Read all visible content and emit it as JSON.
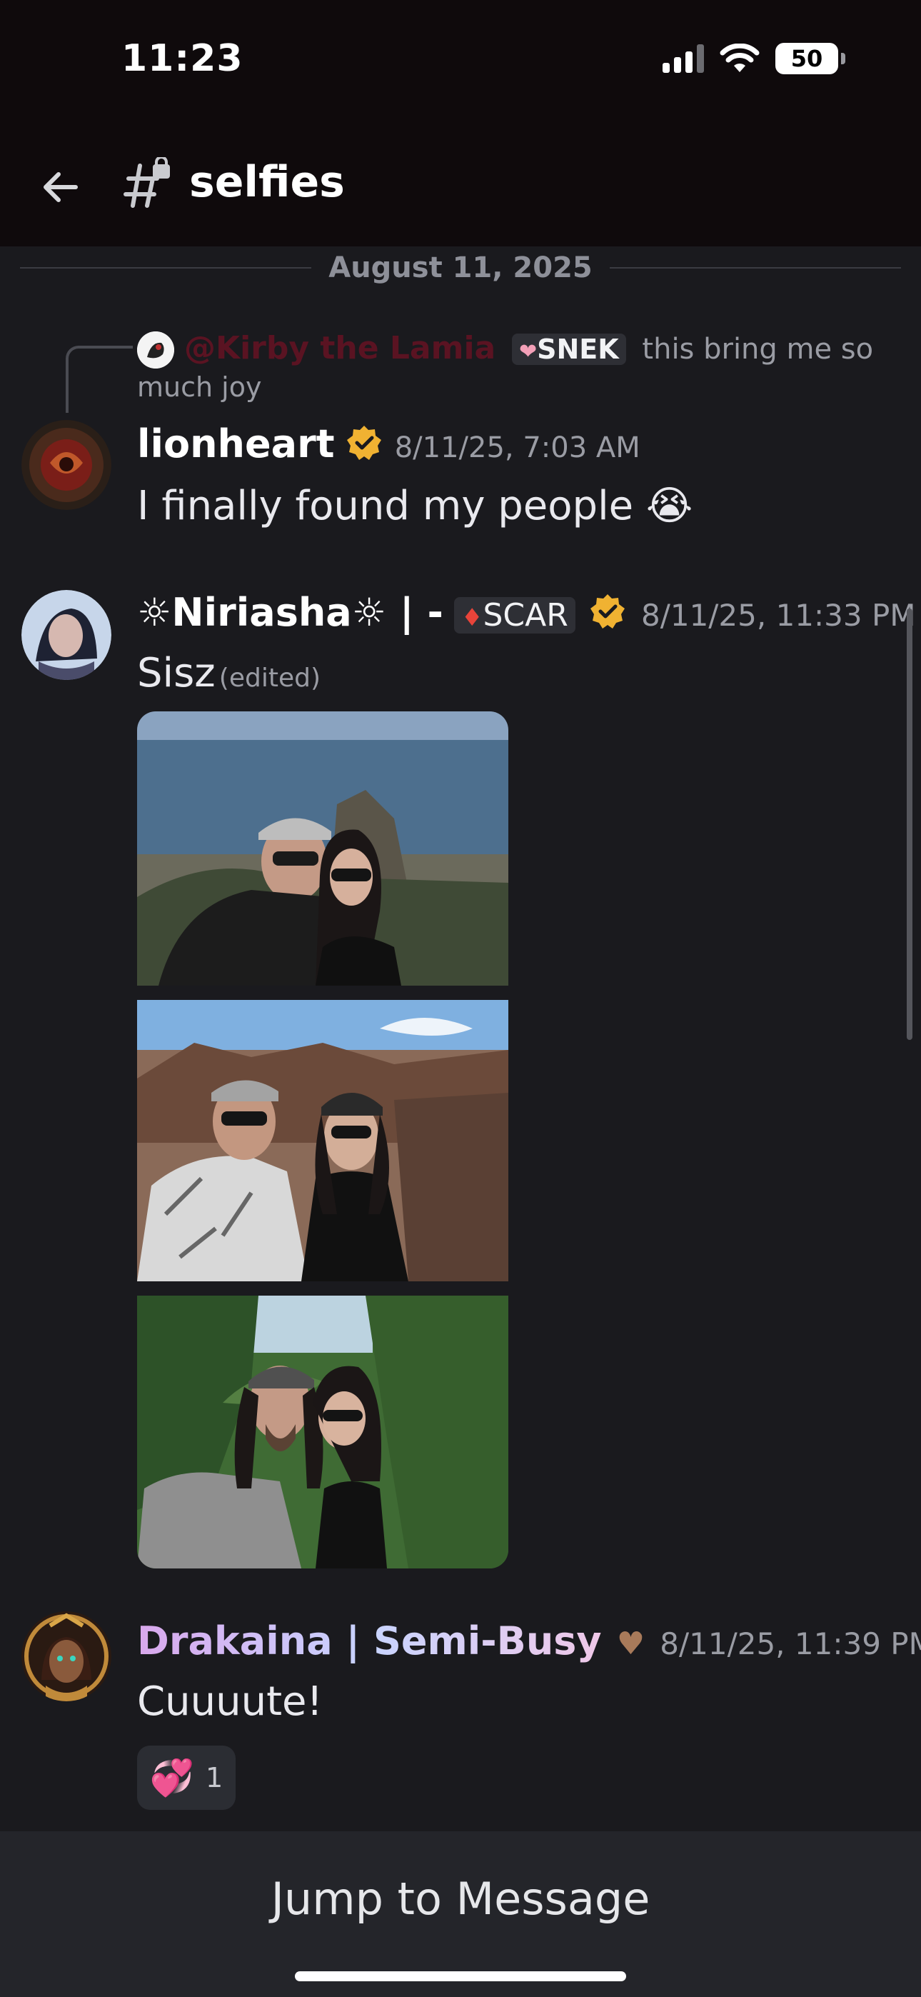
{
  "status_bar": {
    "time": "11:23",
    "battery": "50"
  },
  "header": {
    "channel_name": "selfies"
  },
  "date_divider": "August 11, 2025",
  "reply": {
    "mention": "@Kirby the Lamia",
    "role": "SNEK",
    "text_line1": "this bring me so",
    "text_line2": "much joy"
  },
  "messages": [
    {
      "username": "lionheart",
      "timestamp": "8/11/25, 7:03 AM",
      "text": "I finally found my people 😭"
    },
    {
      "username": "☼Niriasha☼ | -",
      "role": "SCAR",
      "timestamp": "8/11/25, 11:33 PM",
      "text": "Sisz",
      "edited": "(edited)"
    },
    {
      "username": "Drakaina | Semi-Busy",
      "timestamp": "8/11/25, 11:39 PM",
      "text": "Cuuuute!",
      "reaction": {
        "emoji": "💞",
        "count": "1"
      }
    }
  ],
  "footer": {
    "jump_label": "Jump to Message"
  },
  "colors": {
    "background": "#1a1a1e",
    "header": "#0f0a0c",
    "verified": "#f0b232",
    "mention": "#5a1322"
  }
}
